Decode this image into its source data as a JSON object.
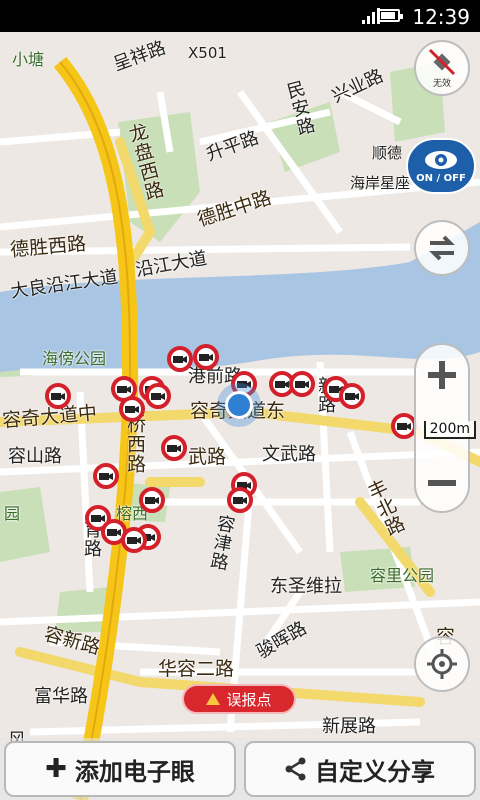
{
  "status": {
    "time": "12:39"
  },
  "map": {
    "labels": {
      "xiaotang": "小塘",
      "chengxiang": "呈祥路",
      "x501": "X501",
      "xingye": "兴业路",
      "minan": "民安路",
      "longpan": "龙盘西路",
      "shengping": "升平路",
      "shunde": "顺德",
      "haian": "海岸星座",
      "desheng_zhong": "德胜中路",
      "desheng_xi": "德胜西路",
      "daliang": "大良沿江大道",
      "yanjiang": "沿江大道",
      "haipang": "海傍公园",
      "gangqian": "港前路",
      "rongqi_zhong": "容奇大道中",
      "rongqi_dong": "容奇大道东",
      "qiaoxi": "桥西路",
      "xinlu": "新路",
      "rongshan": "容山路",
      "wuwu": "武路",
      "wenwu": "文武路",
      "yuan": "园",
      "rongxi": "榕西",
      "yulu": "育路",
      "rongjin": "容津路",
      "fengbei": "丰北路",
      "dongsheng": "东圣维拉",
      "rongli": "容里公园",
      "rongxin": "容新路",
      "junzhou": "骏晖路",
      "huarong": "华容二路",
      "fuhua": "富华路",
      "xinzhan": "新展路",
      "feng": "风",
      "rong_right": "容"
    },
    "scale": "200m"
  },
  "controls": {
    "gps_label": "无效",
    "onoff_label": "ON / OFF",
    "report_label": "误报点"
  },
  "bottom_bar": {
    "add_label": "添加电子眼",
    "share_label": "自定义分享"
  },
  "colors": {
    "accent_red": "#d3202a",
    "river": "#a8c5e3",
    "park": "#c9dfb8"
  }
}
